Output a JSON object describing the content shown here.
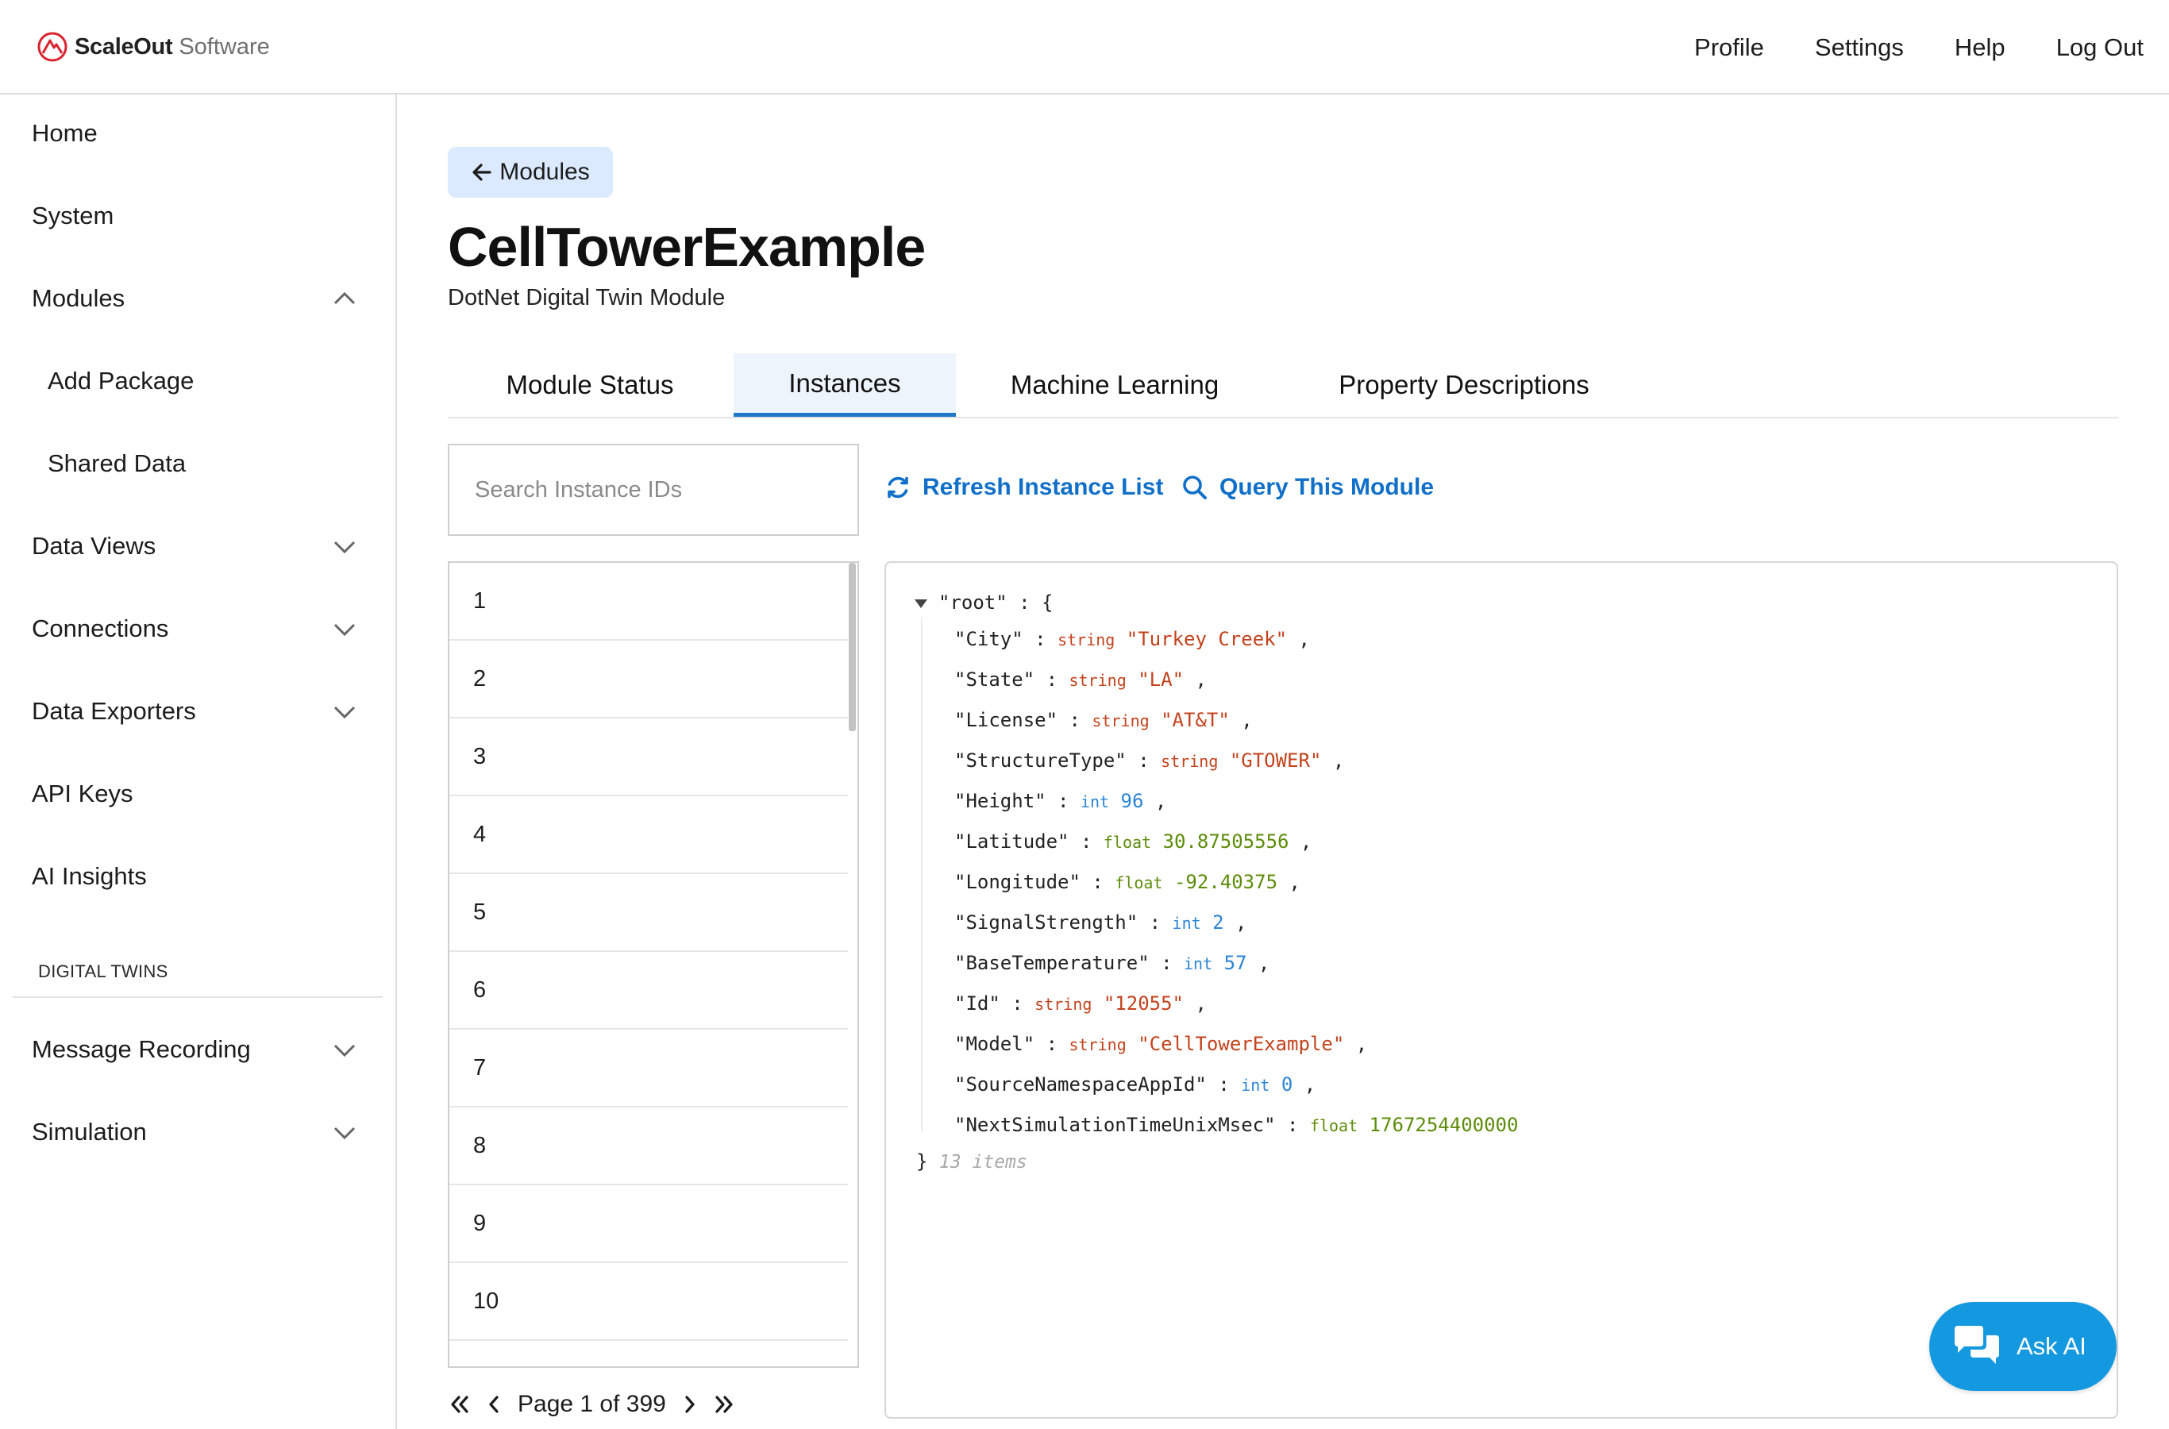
{
  "header": {
    "brand_primary": "ScaleOut",
    "brand_secondary": "Software",
    "nav": [
      "Profile",
      "Settings",
      "Help",
      "Log Out"
    ]
  },
  "sidebar": {
    "items": [
      {
        "label": "Home"
      },
      {
        "label": "System"
      },
      {
        "label": "Modules",
        "chevron": "up"
      },
      {
        "label": "Add Package"
      },
      {
        "label": "Shared Data"
      },
      {
        "label": "Data Views",
        "chevron": "down"
      },
      {
        "label": "Connections",
        "chevron": "down"
      },
      {
        "label": "Data Exporters",
        "chevron": "down"
      },
      {
        "label": "API Keys"
      },
      {
        "label": "AI Insights"
      }
    ],
    "section_label": "DIGITAL TWINS",
    "section_items": [
      {
        "label": "Message Recording",
        "chevron": "down"
      },
      {
        "label": "Simulation",
        "chevron": "down"
      }
    ]
  },
  "main": {
    "back_label": "Modules",
    "title": "CellTowerExample",
    "subtitle": "DotNet Digital Twin Module",
    "tabs": [
      {
        "label": "Module Status"
      },
      {
        "label": "Instances",
        "active": true
      },
      {
        "label": "Machine Learning"
      },
      {
        "label": "Property Descriptions"
      }
    ],
    "search_placeholder": "Search Instance IDs",
    "refresh_label": "Refresh Instance List",
    "query_label": "Query This Module",
    "instances": [
      "1",
      "2",
      "3",
      "4",
      "5",
      "6",
      "7",
      "8",
      "9",
      "10"
    ],
    "pager_label": "Page 1 of 399"
  },
  "json_view": {
    "root_key": "\"root\"",
    "count_label": "13 items",
    "properties": [
      {
        "key": "\"City\"",
        "type": "string",
        "value": "\"Turkey Creek\""
      },
      {
        "key": "\"State\"",
        "type": "string",
        "value": "\"LA\""
      },
      {
        "key": "\"License\"",
        "type": "string",
        "value": "\"AT&T\""
      },
      {
        "key": "\"StructureType\"",
        "type": "string",
        "value": "\"GTOWER\""
      },
      {
        "key": "\"Height\"",
        "type": "int",
        "value": "96"
      },
      {
        "key": "\"Latitude\"",
        "type": "float",
        "value": "30.87505556"
      },
      {
        "key": "\"Longitude\"",
        "type": "float",
        "value": "-92.40375"
      },
      {
        "key": "\"SignalStrength\"",
        "type": "int",
        "value": "2"
      },
      {
        "key": "\"BaseTemperature\"",
        "type": "int",
        "value": "57"
      },
      {
        "key": "\"Id\"",
        "type": "string",
        "value": "\"12055\""
      },
      {
        "key": "\"Model\"",
        "type": "string",
        "value": "\"CellTowerExample\""
      },
      {
        "key": "\"SourceNamespaceAppId\"",
        "type": "int",
        "value": "0"
      },
      {
        "key": "\"NextSimulationTimeUnixMsec\"",
        "type": "float",
        "value": "1767254400000"
      }
    ]
  },
  "ask_ai_label": "Ask AI",
  "colors": {
    "accent": "#1070c9",
    "tab_active_underline": "#1e7ac7",
    "back_button_bg": "#dbeafe",
    "ask_ai_bg": "#1499e0",
    "type_string": "#c4421c",
    "type_int": "#2b84d6",
    "type_float": "#5d8c0a"
  },
  "icons": {
    "brand": "scaleout-logo-icon",
    "back": "arrow-left-icon",
    "refresh": "refresh-icon",
    "query": "search-icon",
    "chevron_up": "chevron-up-icon",
    "chevron_down": "chevron-down-icon",
    "pager": [
      "first-page-icon",
      "prev-page-icon",
      "next-page-icon",
      "last-page-icon"
    ],
    "ask_ai": "chat-bubbles-icon"
  }
}
